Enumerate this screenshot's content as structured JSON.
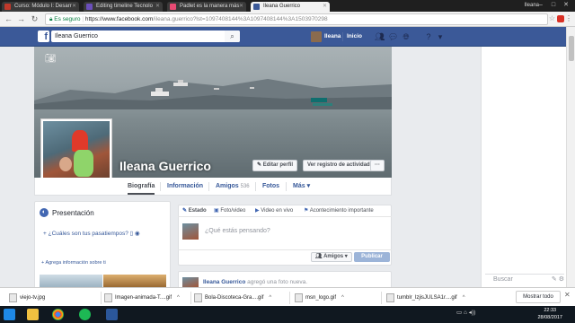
{
  "browser": {
    "tabs": [
      {
        "title": "Curso: Módulo I: Desarr",
        "active": false
      },
      {
        "title": "Editing timeline Tecnolo",
        "active": false
      },
      {
        "title": "Padlet es la manera más",
        "active": false
      },
      {
        "title": "Ileana Guerrico",
        "active": true
      }
    ],
    "profile_name": "Ileana",
    "secure_label": "Es seguro",
    "url_host": "https://www.facebook.com",
    "url_rest": "/ileana.guerrico?lst=1097408144%3A1097408144%3A1503970298"
  },
  "fb_header": {
    "search_value": "Ileana Guerrico",
    "user_name": "Ileana",
    "home_label": "Inicio"
  },
  "profile": {
    "name": "Ileana Guerrico",
    "edit_profile_label": "Editar perfil",
    "activity_log_label": "Ver registro de actividad",
    "more_dots": "···"
  },
  "profile_nav": {
    "biography": "Biografía",
    "info": "Información",
    "friends": "Amigos",
    "friends_count": "536",
    "photos": "Fotos",
    "more": "Más"
  },
  "presentation": {
    "title": "Presentación",
    "hobbies_prompt": "¿Cuáles son tus pasatiempos?",
    "add_info": "Agrega información sobre ti"
  },
  "composer": {
    "tab_status": "Estado",
    "tab_photo": "Foto/video",
    "tab_live": "Video en vivo",
    "tab_event": "Acontecimiento importante",
    "placeholder": "¿Qué estás pensando?",
    "audience": "Amigos",
    "publish": "Publicar"
  },
  "post": {
    "author": "Ileana Guerrico",
    "action_text": "agregó una foto nueva."
  },
  "right_rail": {
    "search_placeholder": "Buscar"
  },
  "downloads": {
    "items": [
      "viejo-tv.jpg",
      "Imagen-animada-T....gif",
      "Bola-Discoteca-Gra....gif",
      "msn_logo.gif",
      "tumblr_lzjisJULSA1r....gif"
    ],
    "show_all": "Mostrar todo"
  },
  "taskbar": {
    "time": "22:33",
    "date": "28/08/2017"
  },
  "colors": {
    "fb_blue": "#3b5998",
    "link": "#365899",
    "publish_disabled": "#9cb4d8"
  }
}
